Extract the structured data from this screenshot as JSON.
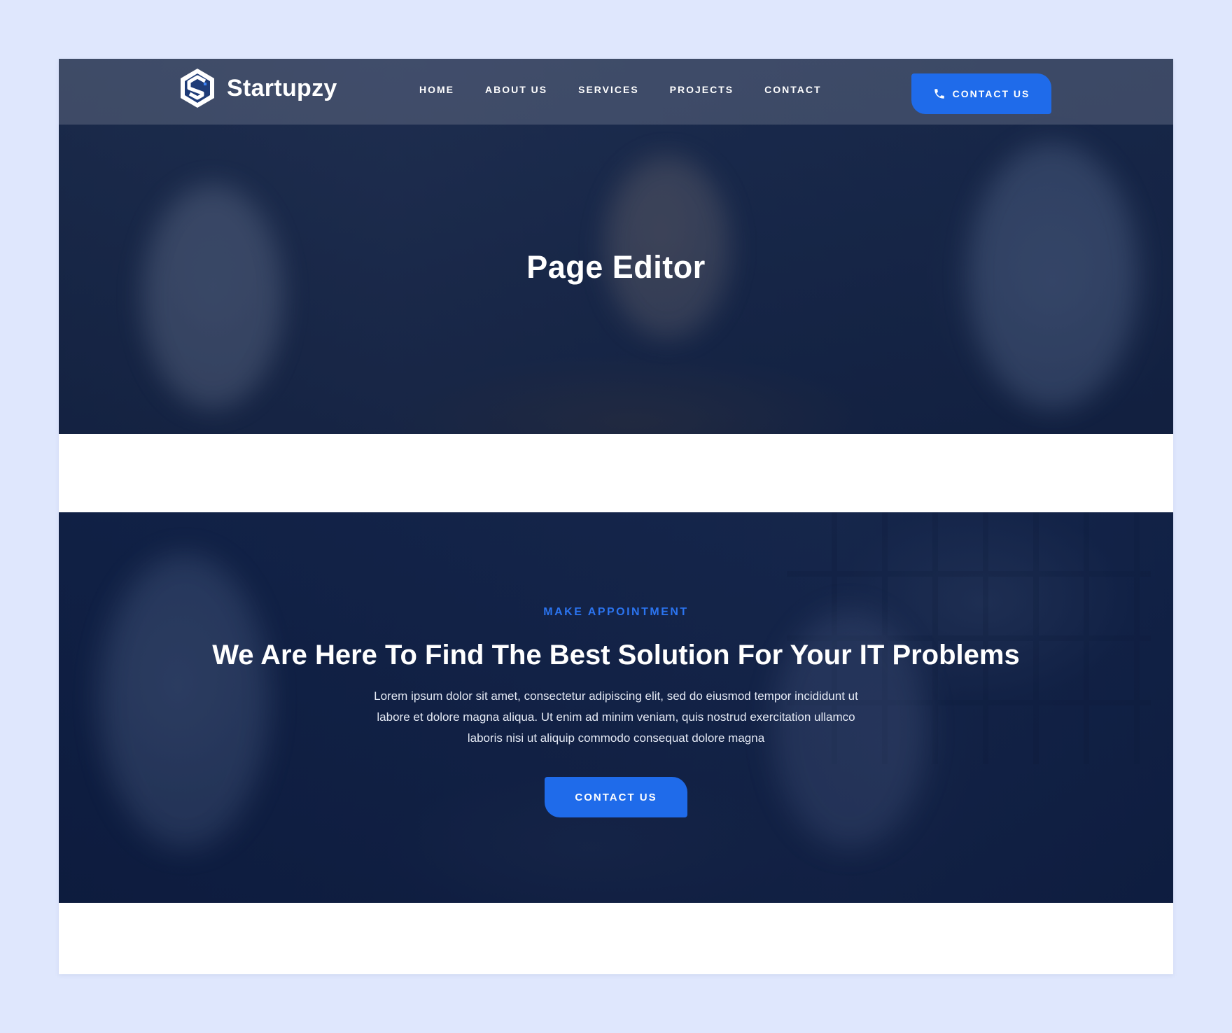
{
  "brand": {
    "name": "Startupzy",
    "logo_icon": "hexagon-s-logo-icon"
  },
  "nav": {
    "items": [
      {
        "label": "HOME"
      },
      {
        "label": "ABOUT US"
      },
      {
        "label": "SERVICES"
      },
      {
        "label": "PROJECTS"
      },
      {
        "label": "CONTACT"
      }
    ],
    "cta_label": "CONTACT US",
    "cta_icon": "phone-icon"
  },
  "hero": {
    "title": "Page Editor"
  },
  "appointment": {
    "eyebrow": "MAKE APPOINTMENT",
    "heading": "We Are Here To Find The Best Solution For Your IT Problems",
    "body": "Lorem ipsum dolor sit amet, consectetur adipiscing elit, sed do eiusmod tempor incididunt ut labore et dolore magna aliqua. Ut enim ad minim veniam, quis nostrud exercitation ullamco laboris nisi ut aliquip commodo consequat dolore magna",
    "button_label": "CONTACT US"
  },
  "colors": {
    "accent": "#1f6bea",
    "eyebrow": "#2b74f0",
    "page_background": "#dfe7fd",
    "overlay": "#0e1e40"
  }
}
